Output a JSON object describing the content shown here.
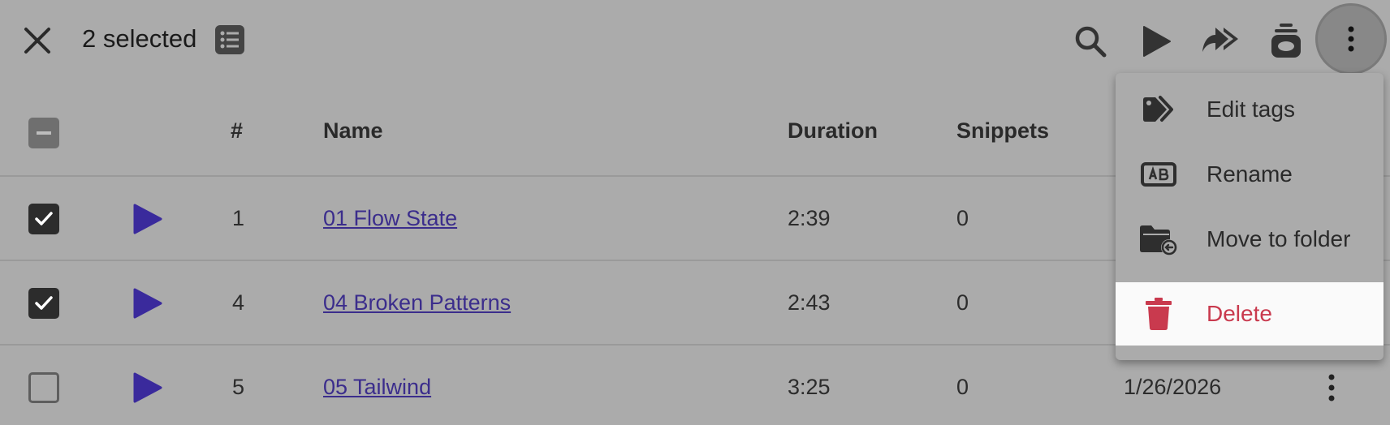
{
  "toolbar": {
    "selected_label": "2 selected",
    "close_icon": "close-icon",
    "list_icon": "list-icon",
    "search_icon": "search-icon",
    "play_icon": "play-icon",
    "share_icon": "share-icon",
    "snippet_icon": "snippet-icon",
    "more_icon": "more-vertical-icon"
  },
  "table": {
    "headers": {
      "number": "#",
      "name": "Name",
      "duration": "Duration",
      "snippets": "Snippets"
    },
    "rows": [
      {
        "checked": true,
        "number": "1",
        "name": "01 Flow State",
        "duration": "2:39",
        "snippets": "0",
        "date": ""
      },
      {
        "checked": true,
        "number": "4",
        "name": "04 Broken Patterns",
        "duration": "2:43",
        "snippets": "0",
        "date": ""
      },
      {
        "checked": false,
        "number": "5",
        "name": "05 Tailwind",
        "duration": "3:25",
        "snippets": "0",
        "date": "1/26/2026"
      }
    ]
  },
  "menu": {
    "items": [
      {
        "label": "Edit tags",
        "icon": "tag-icon"
      },
      {
        "label": "Rename",
        "icon": "rename-icon"
      },
      {
        "label": "Move to folder",
        "icon": "move-folder-icon"
      },
      {
        "label": "Delete",
        "icon": "trash-icon"
      }
    ]
  },
  "colors": {
    "overlay_bg": "#ababab",
    "play_accent": "#3a2a9c",
    "link": "#3b2d8c",
    "delete": "#c93a4e"
  }
}
